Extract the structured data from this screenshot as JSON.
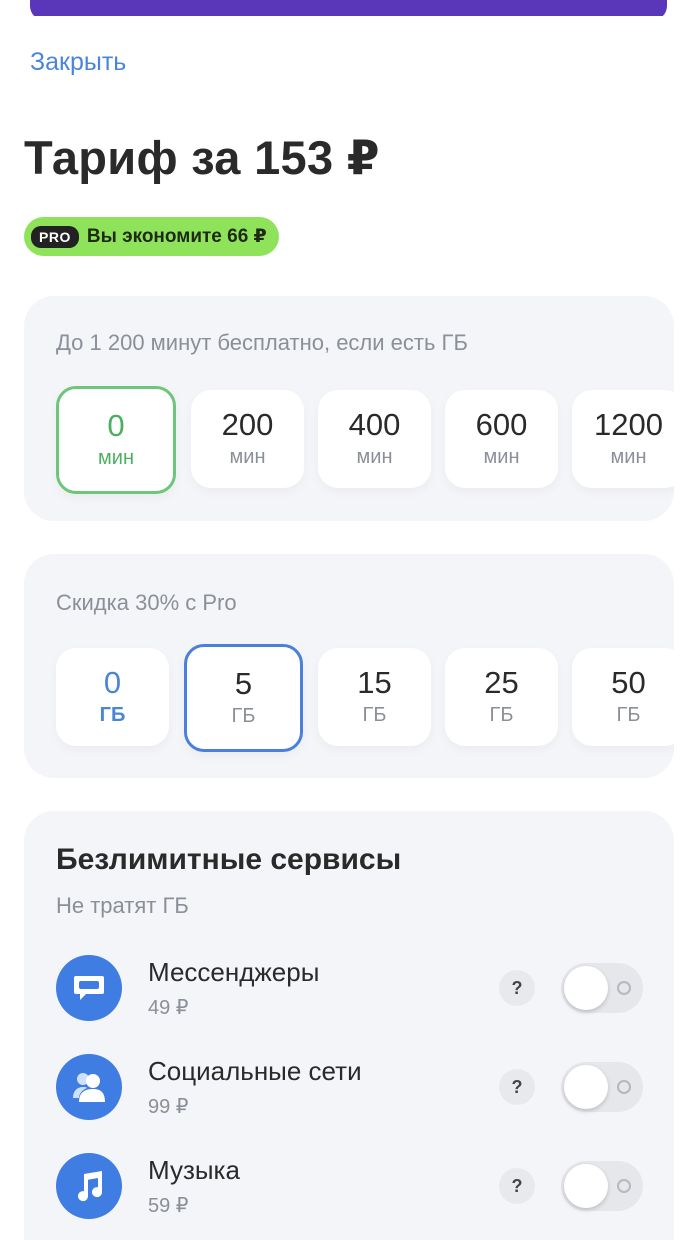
{
  "header": {
    "close_label": "Закрыть",
    "title": "Тариф за 153 ₽",
    "badge": {
      "chip": "PRO",
      "text": "Вы экономите 66 ₽"
    }
  },
  "minutes": {
    "caption": "До 1 200 минут бесплатно, если есть ГБ",
    "selected_index": 0,
    "options": [
      {
        "value": "0",
        "unit": "мин"
      },
      {
        "value": "200",
        "unit": "мин"
      },
      {
        "value": "400",
        "unit": "мин"
      },
      {
        "value": "600",
        "unit": "мин"
      },
      {
        "value": "1200",
        "unit": "мин"
      }
    ]
  },
  "gigabytes": {
    "caption": "Скидка 30% с Pro",
    "selected_index": 1,
    "options": [
      {
        "value": "0",
        "unit": "ГБ"
      },
      {
        "value": "5",
        "unit": "ГБ"
      },
      {
        "value": "15",
        "unit": "ГБ"
      },
      {
        "value": "25",
        "unit": "ГБ"
      },
      {
        "value": "50",
        "unit": "ГБ"
      }
    ]
  },
  "services": {
    "title": "Безлимитные сервисы",
    "subtitle": "Не тратят ГБ",
    "help_label": "?",
    "items": [
      {
        "name": "Мессенджеры",
        "price": "49 ₽",
        "icon": "chat-bubble-icon",
        "enabled": false
      },
      {
        "name": "Социальные сети",
        "price": "99 ₽",
        "icon": "people-icon",
        "enabled": false
      },
      {
        "name": "Музыка",
        "price": "59 ₽",
        "icon": "music-note-icon",
        "enabled": false
      }
    ]
  },
  "colors": {
    "accent_blue": "#4a86d8",
    "selected_green": "#6cc67b",
    "badge_green": "#8fe35a",
    "icon_blue": "#3f7de3",
    "header_strip": "#5a36b8"
  }
}
